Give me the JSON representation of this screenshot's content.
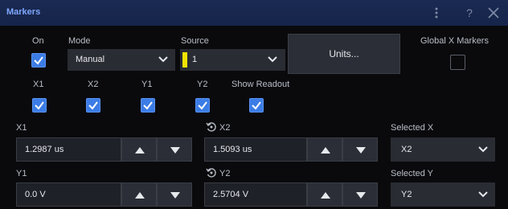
{
  "window": {
    "title": "Markers"
  },
  "controls": {
    "on_label": "On",
    "on_checked": true,
    "mode_label": "Mode",
    "mode_value": "Manual",
    "source_label": "Source",
    "source_value": "1",
    "source_color": "#f3e400",
    "units_button": "Units...",
    "global_x_label": "Global X Markers",
    "global_x_checked": false
  },
  "readouts": {
    "labels": [
      "X1",
      "X2",
      "Y1",
      "Y2",
      "Show Readout"
    ],
    "checked": [
      true,
      true,
      true,
      true,
      true
    ]
  },
  "markers": {
    "x1_label": "X1",
    "x1_value": "1.2987 us",
    "x2_label": "X2",
    "x2_value": "1.5093 us",
    "selected_x_label": "Selected X",
    "selected_x_value": "X2",
    "y1_label": "Y1",
    "y1_value": "0.0 V",
    "y2_label": "Y2",
    "y2_value": "2.5704 V",
    "selected_y_label": "Selected Y",
    "selected_y_value": "Y2"
  },
  "colors": {
    "accent": "#3b7ce6",
    "titlebar": "#1a2a52"
  }
}
